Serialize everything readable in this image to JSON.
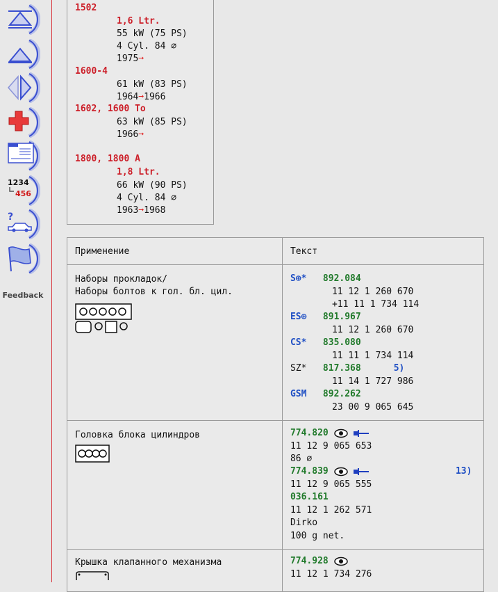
{
  "sidebar": {
    "buttons": [
      {
        "name": "first-page-icon"
      },
      {
        "name": "previous-page-icon"
      },
      {
        "name": "prev-next-icon"
      },
      {
        "name": "first-aid-icon"
      },
      {
        "name": "document-icon"
      },
      {
        "name": "number-search-icon"
      },
      {
        "name": "vehicle-help-icon"
      },
      {
        "name": "flag-icon"
      }
    ],
    "feedback_label": "Feedback"
  },
  "models": [
    {
      "name": "1502",
      "specs": [
        "1,6 Ltr.",
        "55 kW (75 PS)",
        "4 Cyl. 84 ∅",
        "1975"
      ]
    },
    {
      "name": "1600-4",
      "specs": [
        "61 kW (83 PS)",
        "1964",
        "1966"
      ]
    },
    {
      "name": "1602, 1600 To",
      "specs": [
        "63 kW (85 PS)",
        "1966"
      ]
    },
    {
      "name": "1800, 1800 A",
      "specs": [
        "1,8 Ltr.",
        "66 kW (90 PS)",
        "4 Cyl. 84 ∅",
        "1963",
        "1968"
      ]
    }
  ],
  "table": {
    "headers": [
      "Применение",
      "Текст"
    ],
    "rows": [
      {
        "application": [
          "Наборы прокладок/",
          "Наборы болтов к гол. бл. цил."
        ],
        "text": [
          {
            "prefix": "S⊕*",
            "part": "892.084"
          },
          {
            "ref": "11 12 1 260 670"
          },
          {
            "ref": "+11 11 1 734 114"
          },
          {
            "prefix": "ES⊕",
            "part": "891.967"
          },
          {
            "ref": "11 12 1 260 670"
          },
          {
            "prefix": "CS*",
            "part": "835.080"
          },
          {
            "ref": "11 11 1 734 114"
          },
          {
            "prefix": "SZ*",
            "part": "817.368",
            "note": "5)"
          },
          {
            "ref": "11 14 1 727 986"
          },
          {
            "prefix": "GSM",
            "part": "892.262"
          },
          {
            "ref": "23 00 9 065 645"
          }
        ]
      },
      {
        "application": [
          "Головка блока цилиндров"
        ],
        "text": [
          {
            "part": "774.820"
          },
          {
            "ref": "11 12 9 065 653"
          },
          {
            "ref": "86 ∅"
          },
          {
            "part": "774.839",
            "note": "13)"
          },
          {
            "ref": "11 12 9 065 555"
          },
          {
            "part": "036.161"
          },
          {
            "ref": "11 12 1 262 571"
          },
          {
            "ref": "Dirko"
          },
          {
            "ref": "100 g net."
          }
        ]
      },
      {
        "application": [
          "Крышка клапанного механизма"
        ],
        "text": [
          {
            "part": "774.928"
          },
          {
            "ref": "11 12 1 734 276"
          }
        ]
      }
    ]
  },
  "colors": {
    "accent_red": "#cc1e28",
    "part_green": "#217a2b",
    "prefix_blue": "#1f4fc4",
    "nav_blue": "#3a4fd0"
  }
}
